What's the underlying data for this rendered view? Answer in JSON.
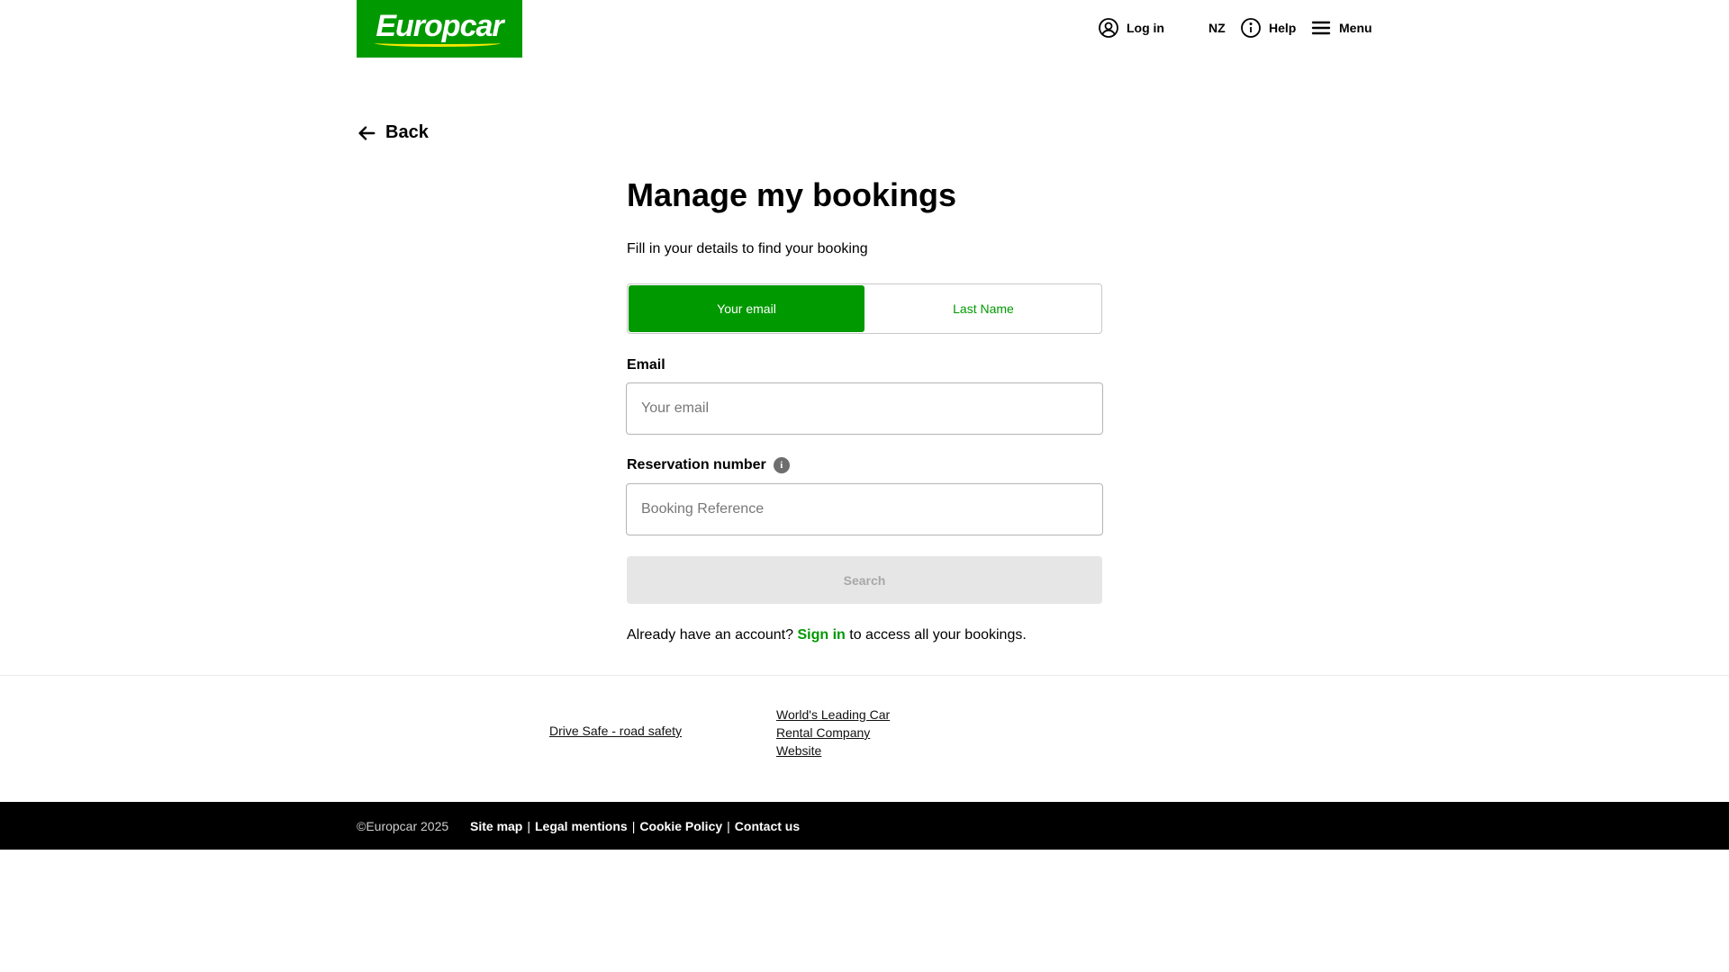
{
  "header": {
    "logo_text": "Europcar",
    "brand_color": "#009900",
    "login_label": "Log in",
    "country": "NZ",
    "help_label": "Help",
    "menu_label": "Menu"
  },
  "back_label": "Back",
  "form": {
    "title": "Manage my bookings",
    "subtitle": "Fill in your details to find your booking",
    "toggle": {
      "selected": "Your email",
      "options": [
        "Your email",
        "Last Name"
      ]
    },
    "email_label": "Email",
    "email_placeholder": "Your email",
    "email_value": "",
    "reservation_label": "Reservation number",
    "reservation_info_icon": "i",
    "reservation_placeholder": "Booking Reference",
    "reservation_value": "",
    "search_label": "Search",
    "account_prefix": "Already have an account?",
    "account_link": "Sign in",
    "account_suffix": "to access all your bookings."
  },
  "footer": {
    "links": [
      "Drive Safe - road safety",
      "World's Leading Car Rental Company Website"
    ],
    "copyright": "©Europcar 2025",
    "legal_links": [
      "Site map",
      "Legal mentions",
      "Cookie Policy",
      "Contact us"
    ],
    "separator": "|"
  }
}
